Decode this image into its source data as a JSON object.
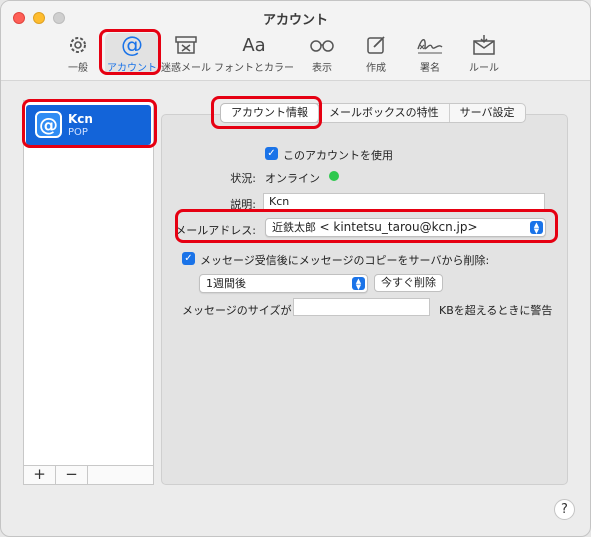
{
  "window": {
    "title": "アカウント"
  },
  "toolbar": {
    "items": [
      {
        "label": "一般",
        "icon": "gear-icon"
      },
      {
        "label": "アカウント",
        "icon": "at-icon",
        "selected": true
      },
      {
        "label": "迷惑メール",
        "icon": "junk-icon"
      },
      {
        "label": "フォントとカラー",
        "icon": "font-icon",
        "glyph": "Aa"
      },
      {
        "label": "表示",
        "icon": "glasses-icon"
      },
      {
        "label": "作成",
        "icon": "compose-icon"
      },
      {
        "label": "署名",
        "icon": "signature-icon"
      },
      {
        "label": "ルール",
        "icon": "rules-icon"
      }
    ]
  },
  "sidebar": {
    "account": {
      "name": "Kcn",
      "type": "POP",
      "icon_glyph": "@"
    },
    "add_label": "+",
    "remove_label": "−"
  },
  "tabs": [
    {
      "label": "アカウント情報",
      "selected": true
    },
    {
      "label": "メールボックスの特性"
    },
    {
      "label": "サーバ設定"
    }
  ],
  "form": {
    "use_account_label": "このアカウントを使用",
    "use_account_checked": true,
    "status_label": "状況:",
    "status_value": "オンライン",
    "status_color": "#2dc84d",
    "description_label": "説明:",
    "description_value": "Kcn",
    "email_label": "メールアドレス:",
    "email_name": "近鉄太郎",
    "email_address": "< kintetsu_tarou@kcn.jp>",
    "remove_copy_label": "メッセージ受信後にメッセージのコピーをサーバから削除:",
    "remove_copy_checked": true,
    "remove_period_value": "1週間後",
    "remove_now_button": "今すぐ削除",
    "size_warning_prefix": "メッセージのサイズが",
    "size_warning_value": "",
    "size_warning_suffix": "KBを超えるときに警告"
  },
  "help_label": "?",
  "colors": {
    "accent": "#1a73e8",
    "highlight": "#e60012",
    "selection": "#1364d9"
  }
}
